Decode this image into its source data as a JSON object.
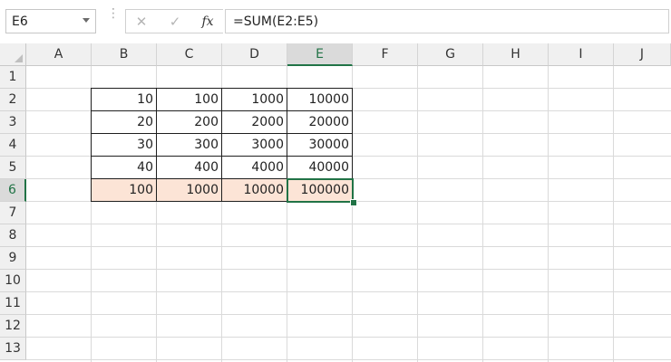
{
  "name_box": {
    "value": "E6"
  },
  "formula_bar": {
    "cancel_glyph": "✕",
    "enter_glyph": "✓",
    "fx_label": "fx",
    "formula": "=SUM(E2:E5)"
  },
  "columns": [
    "A",
    "B",
    "C",
    "D",
    "E",
    "F",
    "G",
    "H",
    "I",
    "J"
  ],
  "rows": [
    "1",
    "2",
    "3",
    "4",
    "5",
    "6",
    "7",
    "8",
    "9",
    "10",
    "11",
    "12",
    "13"
  ],
  "selected_cell": {
    "column": "E",
    "row": "6"
  },
  "cells": {
    "row2": [
      "10",
      "100",
      "1000",
      "10000"
    ],
    "row3": [
      "20",
      "200",
      "2000",
      "20000"
    ],
    "row4": [
      "30",
      "300",
      "3000",
      "30000"
    ],
    "row5": [
      "40",
      "400",
      "4000",
      "40000"
    ],
    "row6": [
      "100",
      "1000",
      "10000",
      "100000"
    ]
  },
  "colors": {
    "accent": "#217346",
    "total_fill": "#fce4d6"
  }
}
